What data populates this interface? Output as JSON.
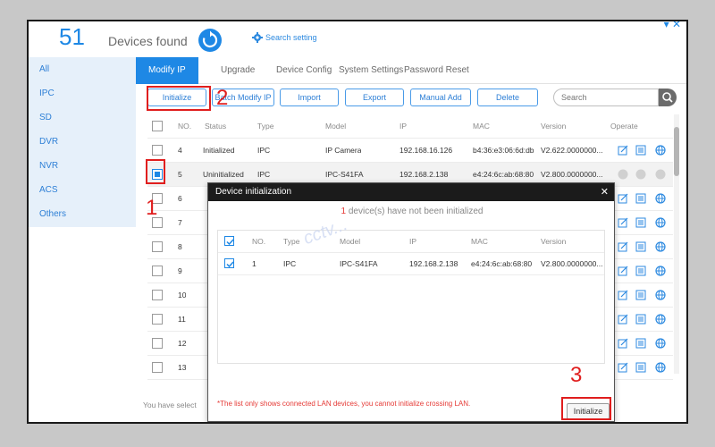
{
  "header": {
    "device_count": "51",
    "devices_found_label": "Devices found",
    "search_setting_label": "Search setting"
  },
  "sidebar": {
    "items": [
      {
        "label": "All"
      },
      {
        "label": "IPC"
      },
      {
        "label": "SD"
      },
      {
        "label": "DVR"
      },
      {
        "label": "NVR"
      },
      {
        "label": "ACS"
      },
      {
        "label": "Others"
      }
    ]
  },
  "tabs": [
    {
      "label": "Modify IP"
    },
    {
      "label": "Upgrade"
    },
    {
      "label": "Device Config"
    },
    {
      "label": "System Settings"
    },
    {
      "label": "Password Reset"
    }
  ],
  "toolbar": {
    "initialize_label": "Initialize",
    "batch_modify_ip_label": "Batch Modify IP",
    "import_label": "Import",
    "export_label": "Export",
    "manual_add_label": "Manual Add",
    "delete_label": "Delete",
    "search_placeholder": "Search"
  },
  "table": {
    "columns": [
      "NO.",
      "Status",
      "Type",
      "Model",
      "IP",
      "MAC",
      "Version",
      "Operate"
    ],
    "rows": [
      {
        "no": "4",
        "status": "Initialized",
        "type": "IPC",
        "model": "IP Camera",
        "ip": "192.168.16.126",
        "mac": "b4:36:e3:06:6d:db",
        "version": "V2.622.0000000...",
        "checked": false
      },
      {
        "no": "5",
        "status": "Uninitialized",
        "type": "IPC",
        "model": "IPC-S41FA",
        "ip": "192.168.2.138",
        "mac": "e4:24:6c:ab:68:80",
        "version": "V2.800.0000000...",
        "checked": true
      },
      {
        "no": "6"
      },
      {
        "no": "7"
      },
      {
        "no": "8"
      },
      {
        "no": "9"
      },
      {
        "no": "10"
      },
      {
        "no": "11"
      },
      {
        "no": "12"
      },
      {
        "no": "13"
      }
    ]
  },
  "footer": {
    "selected_text": "You have select"
  },
  "modal": {
    "title": "Device initialization",
    "count": "1",
    "message_suffix": "device(s) have not been initialized",
    "columns": [
      "NO.",
      "Type",
      "Model",
      "IP",
      "MAC",
      "Version"
    ],
    "rows": [
      {
        "no": "1",
        "type": "IPC",
        "model": "IPC-S41FA",
        "ip": "192.168.2.138",
        "mac": "e4:24:6c:ab:68:80",
        "version": "V2.800.0000000..."
      }
    ],
    "note": "*The list only shows connected LAN devices, you cannot initialize crossing LAN.",
    "initialize_label": "Initialize"
  },
  "annotations": {
    "step1": "1",
    "step2": "2",
    "step3": "3",
    "watermark": "cctv..."
  },
  "colors": {
    "accent": "#1e88e5",
    "annotation_red": "#e01e1e",
    "sidebar_bg": "#e6f0fa"
  }
}
